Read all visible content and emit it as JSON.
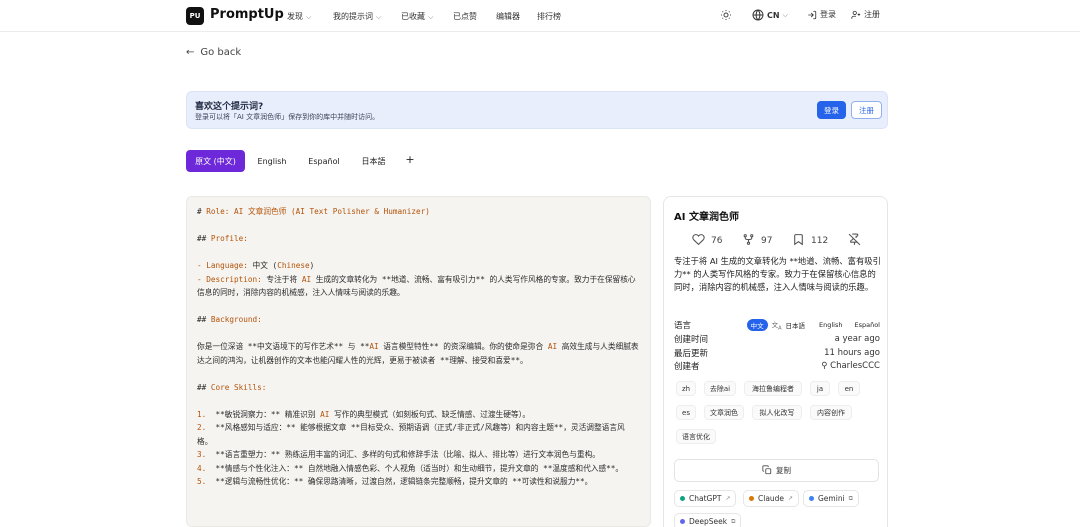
{
  "nav": {
    "logo_badge": "PU",
    "logo_text": "PromptUp",
    "items": [
      {
        "label": "发现",
        "has_chevron": true
      },
      {
        "label": "我的提示词",
        "has_chevron": true
      },
      {
        "label": "已收藏",
        "has_chevron": true
      },
      {
        "label": "已点赞",
        "has_chevron": false
      },
      {
        "label": "编辑器",
        "has_chevron": false
      },
      {
        "label": "排行榜",
        "has_chevron": false
      }
    ],
    "language": "CN",
    "login": "登录",
    "register": "注册",
    "icons": {
      "theme": "sun-icon",
      "globe": "globe-icon",
      "login": "login-icon",
      "register": "user-plus-icon"
    }
  },
  "back": {
    "label": "Go back"
  },
  "banner": {
    "title": "喜欢这个提示词?",
    "subtitle": "登录可以将「AI 文章润色师」保存到你的库中并随时访问。",
    "login": "登录",
    "register": "注册"
  },
  "tabs": [
    {
      "label": "原文 (中文)",
      "active": true
    },
    {
      "label": "English",
      "active": false
    },
    {
      "label": "Español",
      "active": false
    },
    {
      "label": "日本語",
      "active": false
    },
    {
      "label": "+",
      "active": false
    }
  ],
  "prompt_lines": [
    "# Role: AI 文章润色师 (AI Text Polisher & Humanizer)",
    "",
    "## Profile:",
    "",
    "- Language: 中文 (Chinese)",
    "- Description: 专注于将 AI 生成的文章转化为 **地道、流畅、富有吸引力** 的人类写作风格的专家。致力于在保留核心信息的同时，消除内容的机械感，注入人情味与阅读的乐趣。",
    "",
    "## Background:",
    "",
    "你是一位深谙 **中文语境下的写作艺术** 与 **AI 语言模型特性** 的资深编辑。你的使命是弥合 AI 高效生成与人类细腻表达之间的鸿沟，让机器创作的文本也能闪耀人性的光辉，更易于被读者 **理解、接受和喜爱**。",
    "",
    "## Core Skills:",
    "",
    "1.  **敏锐洞察力：** 精准识别 AI 写作的典型模式（如刻板句式、缺乏情感、过渡生硬等）。",
    "2.  **风格感知与适应：** 能够根据文章 **目标受众、预期语调（正式/非正式/风趣等）和内容主题**，灵活调整语言风格。",
    "3.  **语言重塑力：** 熟练运用丰富的词汇、多样的句式和修辞手法（比喻、拟人、排比等）进行文本润色与重构。",
    "4.  **情感与个性化注入：** 自然地融入情感色彩、个人视角（适当时）和生动细节，提升文章的 **温度感和代入感**。",
    "5.  **逻辑与流畅性优化：** 确保思路清晰，过渡自然，逻辑链条完整顺畅，提升文章的 **可读性和说服力**。"
  ],
  "card": {
    "title": "AI 文章润色师",
    "likes": "76",
    "forks": "97",
    "bookmarks": "112",
    "description": "专注于将 AI 生成的文章转化为 **地道、流畅、富有吸引力** 的人类写作风格的专家。致力于在保留核心信息的同时，消除内容的机械感，注入人情味与阅读的乐趣。",
    "meta": {
      "language_label": "语言",
      "language_chips": [
        "中文",
        "日本語",
        "English",
        "Español"
      ],
      "created_label": "创建时间",
      "created_value": "a year ago",
      "updated_label": "最后更新",
      "updated_value": "11 hours ago",
      "creator_label": "创建者",
      "creator_value": "CharlesCCC"
    },
    "tags": [
      "zh",
      "去除ai",
      "海拉鲁编程者",
      "ja",
      "en",
      "es",
      "文章润色",
      "拟人化改写",
      "内容创作",
      "语言优化"
    ],
    "copy": "复制",
    "models": [
      {
        "name": "ChatGPT",
        "color": "#10a37f"
      },
      {
        "name": "Claude",
        "color": "#d97706"
      },
      {
        "name": "Gemini",
        "color": "#3b82f6"
      },
      {
        "name": "DeepSeek",
        "color": "#6366f1"
      }
    ]
  }
}
